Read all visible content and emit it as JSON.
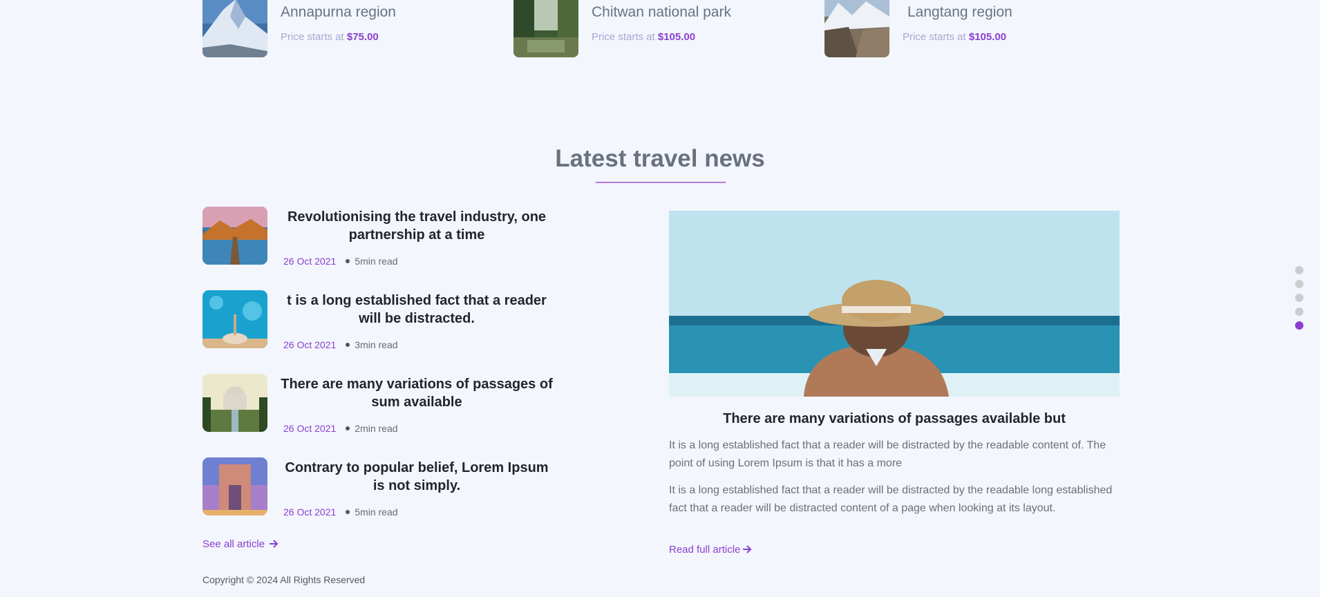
{
  "destinations": [
    {
      "name": "Annapurna region",
      "price_label": "Price starts at",
      "price": "$75.00"
    },
    {
      "name": "Chitwan national park",
      "price_label": "Price starts at",
      "price": "$105.00"
    },
    {
      "name": "Langtang region",
      "price_label": "Price starts at",
      "price": "$105.00"
    }
  ],
  "news": {
    "heading": "Latest travel news",
    "items": [
      {
        "title": "Revolutionising the travel industry, one partnership at a time",
        "date": "26 Oct 2021",
        "read_time": "5min read"
      },
      {
        "title": "t is a long established fact that a reader will be distracted.",
        "date": "26 Oct 2021",
        "read_time": "3min read"
      },
      {
        "title": "There are many variations of passages of sum available",
        "date": "26 Oct 2021",
        "read_time": "2min read"
      },
      {
        "title": "Contrary to popular belief, Lorem Ipsum is not simply.",
        "date": "26 Oct 2021",
        "read_time": "5min read"
      }
    ],
    "see_all": "See all article",
    "featured": {
      "title": "There are many variations of passages available but",
      "paragraph1": "It is a long established fact that a reader will be distracted by the readable content of. The point of using Lorem Ipsum is that it has a more",
      "paragraph2": "It is a long established fact that a reader will be distracted by the readable long established fact that a reader will be distracted content of a page when looking at its layout.",
      "read_more": "Read full article"
    }
  },
  "footer": {
    "copyright": "Copyright © 2024 All Rights Reserved"
  },
  "side_nav": {
    "dot_count": 5,
    "active_index": 4
  },
  "colors": {
    "accent": "#8a3fd0",
    "background": "#f3f6fd",
    "heading": "#6a717c"
  }
}
